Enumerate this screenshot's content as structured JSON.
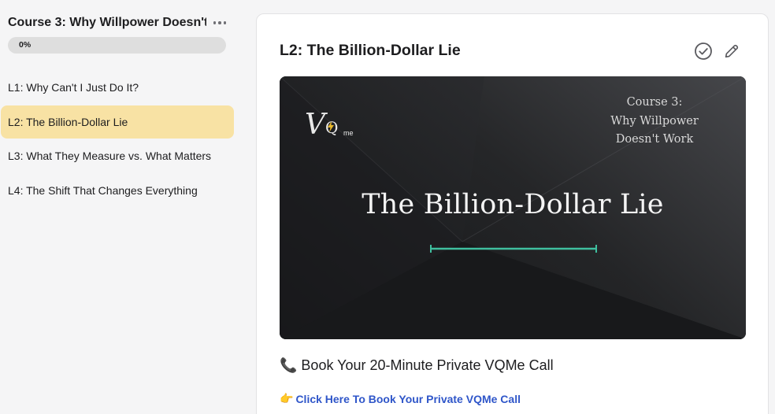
{
  "sidebar": {
    "course_title": "Course 3: Why Willpower Doesn't...",
    "progress": {
      "label": "0%",
      "fraction": 0
    },
    "lessons": [
      {
        "label": "L1: Why Can't I Just Do It?",
        "active": false
      },
      {
        "label": "L2: The Billion-Dollar Lie",
        "active": true
      },
      {
        "label": "L3: What They Measure vs. What Matters",
        "active": false
      },
      {
        "label": "L4: The Shift That Changes Everything",
        "active": false
      }
    ]
  },
  "main": {
    "lesson_title": "L2: The Billion-Dollar Lie",
    "thumbnail": {
      "logo_v": "V",
      "logo_q": "Q",
      "logo_me": "me",
      "course_lines": [
        "Course 3:",
        "Why Willpower",
        "Doesn't Work"
      ],
      "title": "The Billion-Dollar Lie",
      "accent_color": "#3fbf9f"
    },
    "cta_icon": "telephone-icon",
    "cta_heading": "Book Your 20-Minute Private VQMe Call",
    "cta_link_icon": "pointing-hand-icon",
    "cta_link": "Click Here To Book Your Private VQMe Call"
  },
  "colors": {
    "active_lesson_bg": "#f8e2a4",
    "link": "#2f56c9",
    "progress_track": "#dedede"
  }
}
